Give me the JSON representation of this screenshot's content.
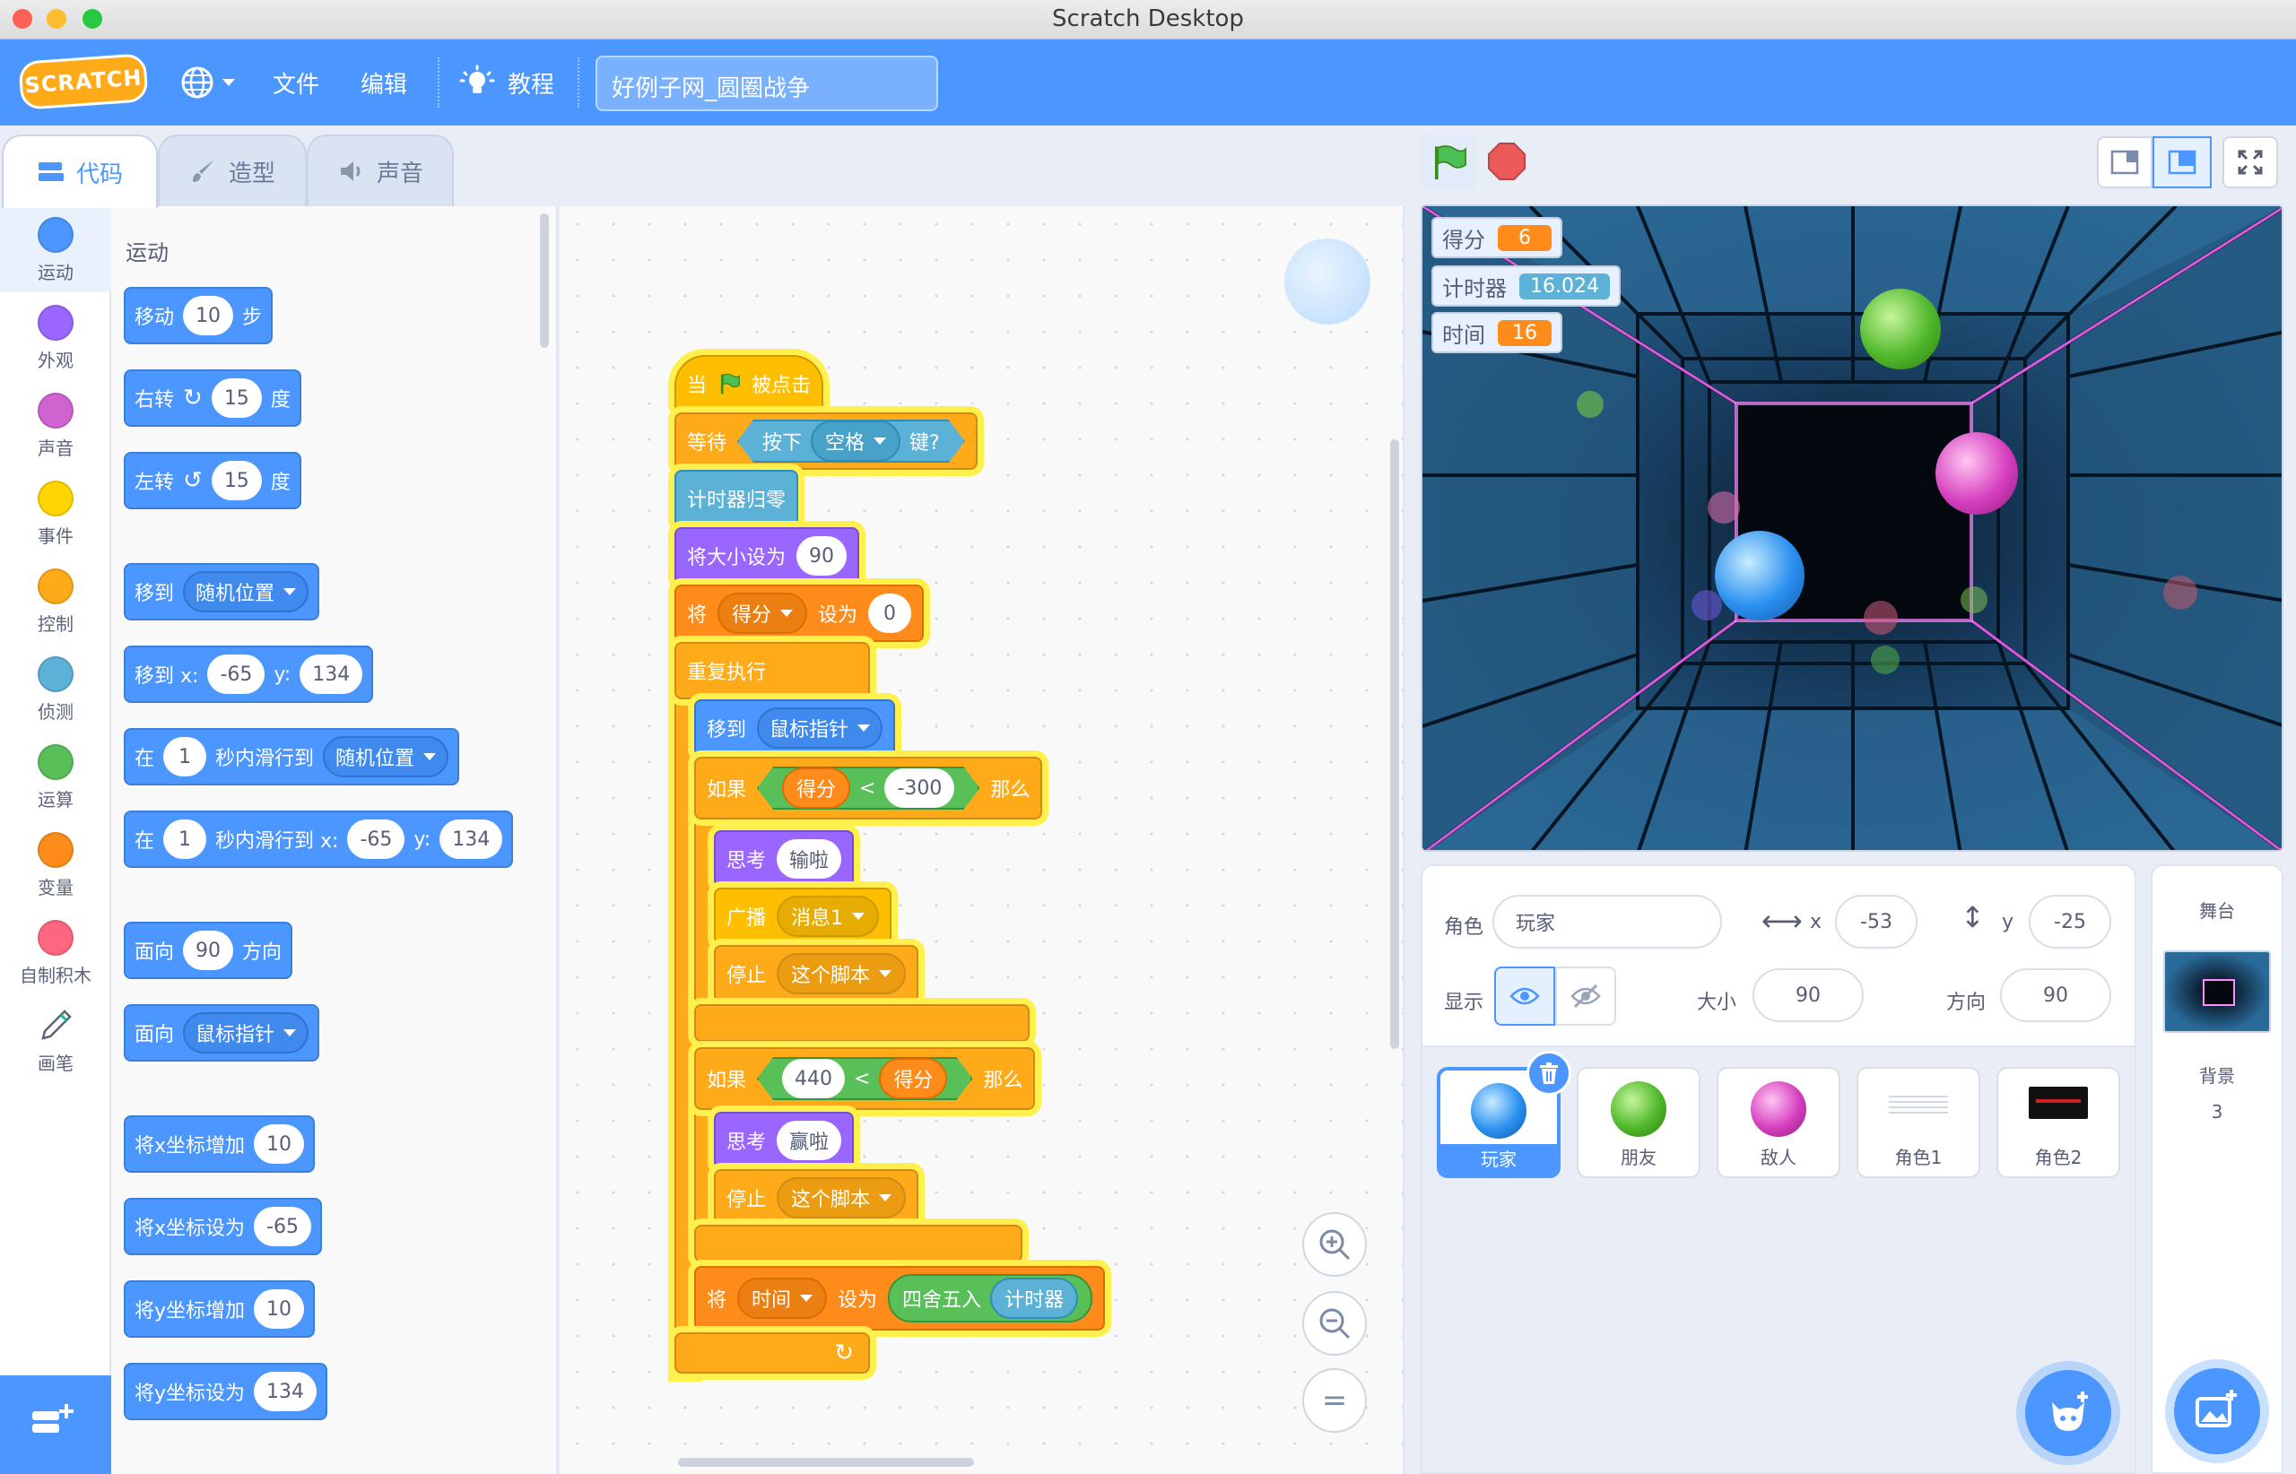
{
  "window": {
    "title": "Scratch Desktop"
  },
  "menubar": {
    "logo": "SCRATCH",
    "file": "文件",
    "edit": "编辑",
    "tutorials": "教程",
    "project_name": "好例子网_圆圈战争"
  },
  "tabs": {
    "code": "代码",
    "costumes": "造型",
    "sounds": "声音"
  },
  "categories": [
    {
      "label": "运动",
      "color": "#4c97ff"
    },
    {
      "label": "外观",
      "color": "#9966ff"
    },
    {
      "label": "声音",
      "color": "#cf63cf"
    },
    {
      "label": "事件",
      "color": "#ffd500"
    },
    {
      "label": "控制",
      "color": "#ffab19"
    },
    {
      "label": "侦测",
      "color": "#5cb1d6"
    },
    {
      "label": "运算",
      "color": "#59c059"
    },
    {
      "label": "变量",
      "color": "#ff8c1a"
    },
    {
      "label": "自制积木",
      "color": "#ff6680"
    },
    {
      "label": "画笔",
      "color": "#0fbd8c"
    }
  ],
  "palette": {
    "heading": "运动",
    "move": {
      "a": "移动",
      "v": "10",
      "b": "步"
    },
    "turn_right": {
      "a": "右转",
      "v": "15",
      "b": "度"
    },
    "turn_left": {
      "a": "左转",
      "v": "15",
      "b": "度"
    },
    "goto": {
      "a": "移到",
      "dd": "随机位置"
    },
    "goto_xy": {
      "a": "移到 x:",
      "x": "-65",
      "yl": "y:",
      "y": "134"
    },
    "glide": {
      "a": "在",
      "v": "1",
      "b": "秒内滑行到",
      "dd": "随机位置"
    },
    "glide_xy": {
      "a": "在",
      "v": "1",
      "b": "秒内滑行到 x:",
      "x": "-65",
      "yl": "y:",
      "y": "134"
    },
    "point_dir": {
      "a": "面向",
      "v": "90",
      "b": "方向"
    },
    "point_towards": {
      "a": "面向",
      "dd": "鼠标指针"
    },
    "change_x": {
      "a": "将x坐标增加",
      "v": "10"
    },
    "set_x": {
      "a": "将x坐标设为",
      "v": "-65"
    },
    "change_y": {
      "a": "将y坐标增加",
      "v": "10"
    },
    "set_y": {
      "a": "将y坐标设为",
      "v": "134"
    }
  },
  "script": {
    "hat": {
      "a": "当",
      "b": "被点击"
    },
    "wait": {
      "a": "等待",
      "b": "按下",
      "key": "空格",
      "c": "键?"
    },
    "reset_timer": "计时器归零",
    "set_size": {
      "a": "将大小设为",
      "v": "90"
    },
    "set_score": {
      "a": "将",
      "var": "得分",
      "b": "设为",
      "v": "0"
    },
    "forever": "重复执行",
    "goto": {
      "a": "移到",
      "dd": "鼠标指针"
    },
    "if1": {
      "a": "如果",
      "var": "得分",
      "op": "<",
      "v": "-300",
      "b": "那么"
    },
    "think1": {
      "a": "思考",
      "v": "输啦"
    },
    "broadcast": {
      "a": "广播",
      "v": "消息1"
    },
    "stop1": {
      "a": "停止",
      "dd": "这个脚本"
    },
    "if2": {
      "a": "如果",
      "v": "440",
      "op": "<",
      "var": "得分",
      "b": "那么"
    },
    "think2": {
      "a": "思考",
      "v": "赢啦"
    },
    "stop2": {
      "a": "停止",
      "dd": "这个脚本"
    },
    "set_time": {
      "a": "将",
      "var": "时间",
      "b": "设为",
      "round": "四舍五入",
      "timer": "计时器"
    }
  },
  "monitors": [
    {
      "label": "得分",
      "value": "6",
      "color": "#ff8c1a"
    },
    {
      "label": "计时器",
      "value": "16.024",
      "color": "#5cb1d6"
    },
    {
      "label": "时间",
      "value": "16",
      "color": "#ff8c1a"
    }
  ],
  "sprite_info": {
    "sprite_label": "角色",
    "sprite_name": "玩家",
    "x_label": "x",
    "x": "-53",
    "y_label": "y",
    "y": "-25",
    "show_label": "显示",
    "size_label": "大小",
    "size": "90",
    "direction_label": "方向",
    "direction": "90"
  },
  "sprites": [
    {
      "name": "玩家",
      "color": "#2a90f0",
      "selected": true
    },
    {
      "name": "朋友",
      "color": "#4fb82a"
    },
    {
      "name": "敌人",
      "color": "#d63fbf"
    },
    {
      "name": "角色1",
      "color": "#cfd8e6"
    },
    {
      "name": "角色2",
      "color": "#111111"
    }
  ],
  "stage_panel": {
    "title": "舞台",
    "backdrops_label": "背景",
    "backdrops_count": "3"
  }
}
